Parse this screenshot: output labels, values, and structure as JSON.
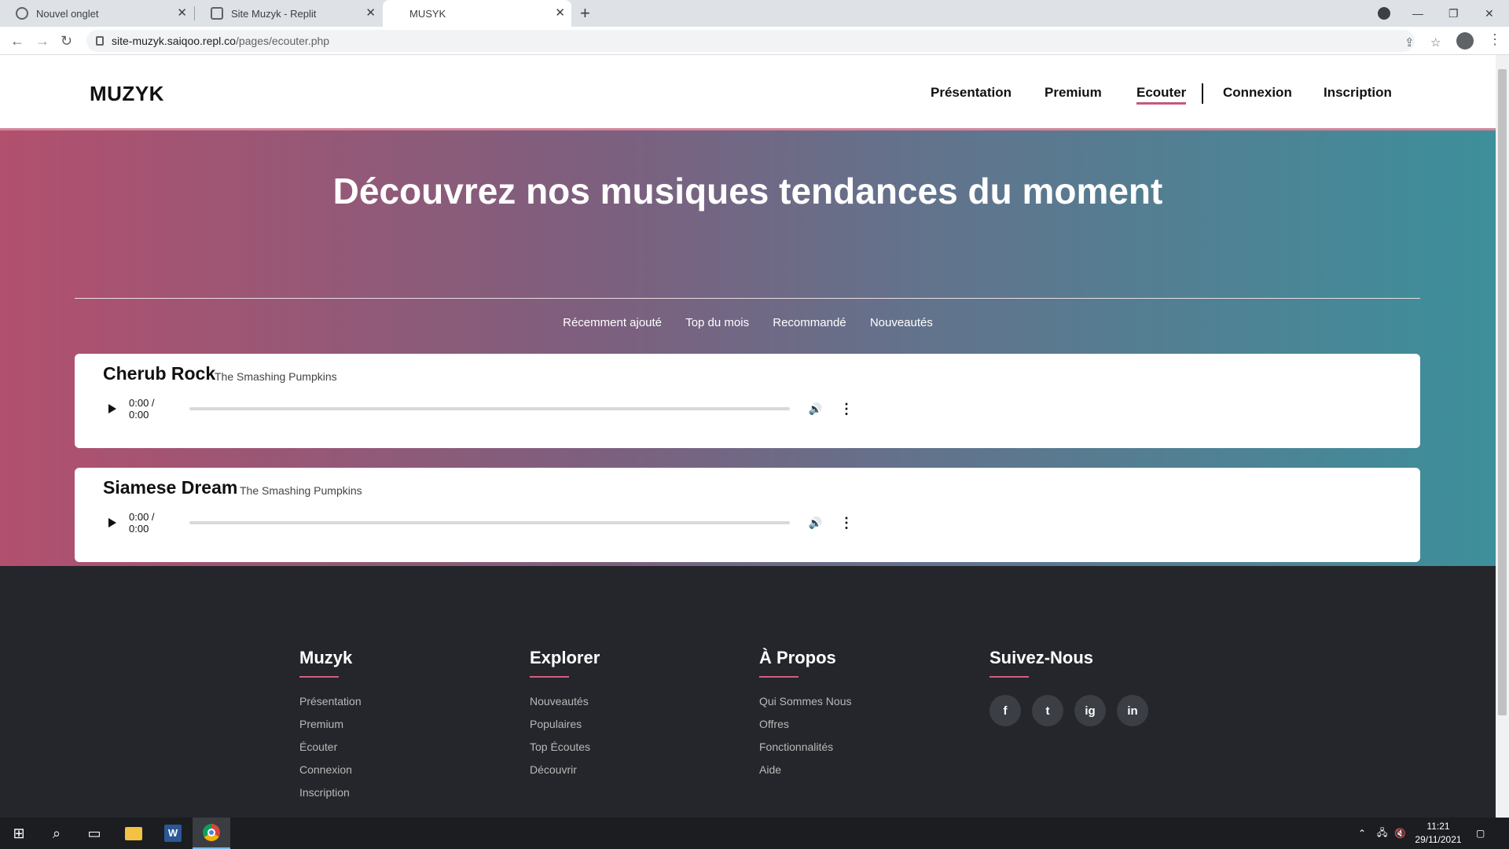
{
  "browser": {
    "tabs": [
      {
        "label": "Nouvel onglet"
      },
      {
        "label": "Site Muzyk - Replit"
      },
      {
        "label": "MUSYK"
      }
    ],
    "address": {
      "host": "site-muzyk.saiqoo.repl.co",
      "path": "/pages/ecouter.php"
    }
  },
  "site": {
    "logo": "MUZYK",
    "nav": [
      {
        "label": "Présentation"
      },
      {
        "label": "Premium"
      },
      {
        "label": "Ecouter"
      },
      {
        "label": "Connexion"
      },
      {
        "label": "Inscription"
      }
    ]
  },
  "hero": {
    "title": "Découvrez nos musiques tendances du moment",
    "filters": [
      "Récemment ajouté",
      "Top du mois",
      "Recommandé",
      "Nouveautés"
    ]
  },
  "tracks": [
    {
      "title": "Cherub Rock",
      "artist": "The Smashing Pumpkins",
      "time": "0:00 / 0:00"
    },
    {
      "title": "Siamese Dream",
      "artist": "The Smashing Pumpkins",
      "time": "0:00 / 0:00"
    }
  ],
  "footer": {
    "columns": [
      {
        "heading": "Muzyk",
        "items": [
          "Présentation",
          "Premium",
          "Écouter",
          "Connexion",
          "Inscription"
        ]
      },
      {
        "heading": "Explorer",
        "items": [
          "Nouveautés",
          "Populaires",
          "Top Écoutes",
          "Découvrir"
        ]
      },
      {
        "heading": "À Propos",
        "items": [
          "Qui Sommes Nous",
          "Offres",
          "Fonctionnalités",
          "Aide"
        ]
      },
      {
        "heading": "Suivez-Nous",
        "socials": [
          "f",
          "t",
          "ig",
          "in"
        ]
      }
    ]
  },
  "taskbar": {
    "time": "11:21",
    "date": "29/11/2021"
  },
  "colors": {
    "accent": "#c45a7a",
    "hero_start": "#b2506e",
    "hero_end": "#3d8f9b",
    "footer_bg": "#24262b"
  }
}
